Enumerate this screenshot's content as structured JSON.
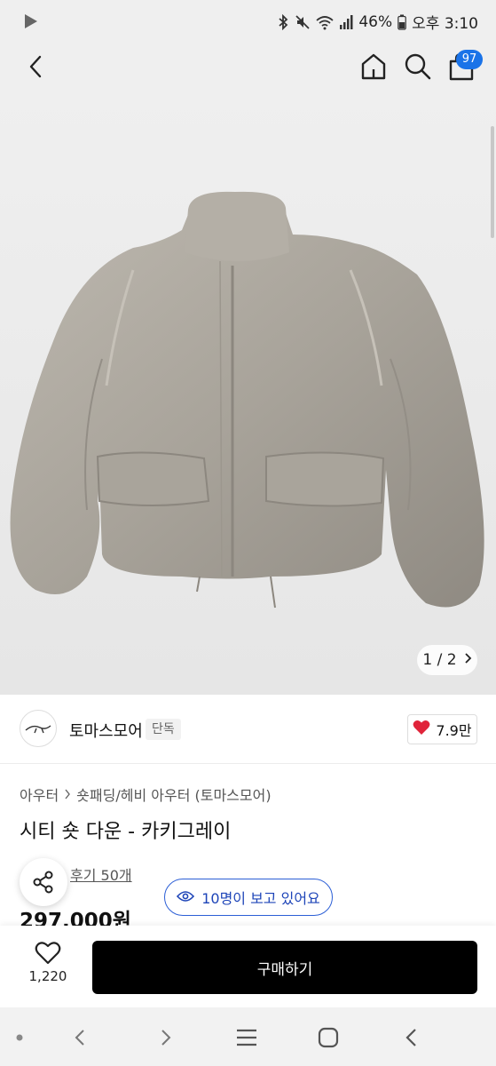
{
  "status_bar": {
    "battery": "46%",
    "time": "오후 3:10",
    "icons": [
      "play-store-icon",
      "bluetooth-icon",
      "mute-icon",
      "wifi-icon",
      "signal-icon",
      "battery-icon"
    ]
  },
  "top_nav": {
    "icons": [
      "back-icon",
      "home-icon",
      "search-icon",
      "shopping-bag-icon"
    ],
    "cart_count": "97"
  },
  "gallery": {
    "pager": "1 / 2"
  },
  "brand": {
    "name": "토마스모어",
    "tag": "단독",
    "likes": "7.9만"
  },
  "product": {
    "breadcrumb": [
      "아우터",
      "숏패딩/헤비 아우터 (토마스모어)"
    ],
    "title": "시티 숏 다운 - 카키그레이",
    "reviews": "후기 50개",
    "viewers": "10명이 보고 있어요",
    "price": "297,000원"
  },
  "bottom_bar": {
    "wish_count": "1,220",
    "buy_label": "구매하기"
  },
  "colors": {
    "accent_blue": "#1a73e8",
    "viewers_blue": "#2c5fd6",
    "heart_red": "#e0243a",
    "buy_button": "#000000"
  }
}
